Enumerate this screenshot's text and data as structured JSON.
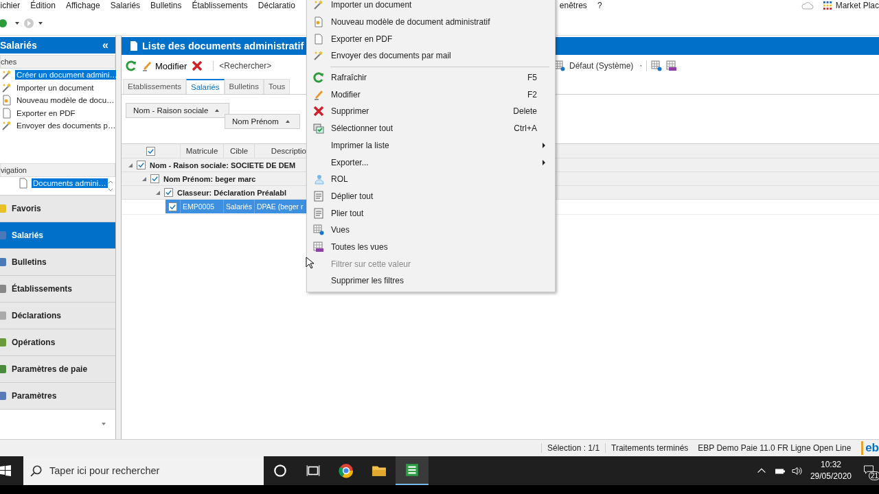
{
  "menu_bar": {
    "items": [
      "ichier",
      "Édition",
      "Affichage",
      "Salariés",
      "Bulletins",
      "Établissements",
      "Déclaratio"
    ],
    "items_right": [
      "enêtres",
      "?"
    ],
    "marketplace": "Market Plac"
  },
  "left_panel": {
    "title": "Salariés",
    "collapse": "«",
    "tasks_header": "ches",
    "tasks": [
      {
        "label": "Créer un document admini…",
        "selected": true
      },
      {
        "label": "Importer un document",
        "selected": false
      },
      {
        "label": "Nouveau modèle de docu…",
        "selected": false
      },
      {
        "label": "Exporter en PDF",
        "selected": false
      },
      {
        "label": "Envoyer des documents p…",
        "selected": false
      }
    ],
    "navigation_header": "vigation",
    "navigation": [
      {
        "label": "Documents admini…",
        "selected": true
      }
    ],
    "modules": [
      {
        "label": "Favoris",
        "selected": false
      },
      {
        "label": "Salariés",
        "selected": true
      },
      {
        "label": "Bulletins",
        "selected": false
      },
      {
        "label": "Établissements",
        "selected": false
      },
      {
        "label": "Déclarations",
        "selected": false
      },
      {
        "label": "Opérations",
        "selected": false
      },
      {
        "label": "Paramètres de paie",
        "selected": false
      },
      {
        "label": "Paramètres",
        "selected": false
      }
    ]
  },
  "main": {
    "title": "Liste des documents administratif",
    "toolbar": {
      "edit": "Modifier",
      "search_placeholder": "<Rechercher>",
      "view": "Défaut (Système)"
    },
    "tabs": [
      {
        "label": "Etablissements",
        "selected": false
      },
      {
        "label": "Salariés",
        "selected": true
      },
      {
        "label": "Bulletins",
        "selected": false
      },
      {
        "label": "Tous",
        "selected": false
      }
    ],
    "group_by": [
      "Nom - Raison sociale",
      "Nom Prénom"
    ],
    "grid": {
      "all_checked": true,
      "columns": [
        "Matricule",
        "Cible",
        "Descriptio"
      ],
      "groups": [
        {
          "label": "Nom - Raison sociale: SOCIETE DE DEM",
          "checked": true,
          "expanded": true,
          "children": [
            {
              "label": "Nom Prénom: beger marc",
              "checked": true,
              "expanded": true,
              "children": [
                {
                  "label": "Classeur: Déclaration Préalabl",
                  "checked": true,
                  "expanded": true,
                  "rows": [
                    {
                      "checked": true,
                      "selected": true,
                      "cells": [
                        "EMP0005",
                        "Salariés",
                        "DPAE (beger r"
                      ]
                    }
                  ]
                }
              ]
            }
          ]
        }
      ]
    }
  },
  "context_menu": {
    "items": [
      {
        "kind": "item",
        "label": "Importer un document"
      },
      {
        "kind": "item",
        "label": "Nouveau modèle de document administratif"
      },
      {
        "kind": "item",
        "label": "Exporter en PDF"
      },
      {
        "kind": "item",
        "label": "Envoyer des documents par mail"
      },
      {
        "kind": "separator"
      },
      {
        "kind": "item",
        "label": "Rafraîchir",
        "shortcut": "F5"
      },
      {
        "kind": "item",
        "label": "Modifier",
        "shortcut": "F2"
      },
      {
        "kind": "item",
        "label": "Supprimer",
        "shortcut": "Delete"
      },
      {
        "kind": "item",
        "label": "Sélectionner tout",
        "shortcut": "Ctrl+A"
      },
      {
        "kind": "item",
        "label": "Imprimer la liste",
        "submenu": true
      },
      {
        "kind": "item",
        "label": "Exporter...",
        "submenu": true
      },
      {
        "kind": "item",
        "label": "ROL"
      },
      {
        "kind": "item",
        "label": "Déplier tout"
      },
      {
        "kind": "item",
        "label": "Plier tout"
      },
      {
        "kind": "item",
        "label": "Vues"
      },
      {
        "kind": "item",
        "label": "Toutes les vues"
      },
      {
        "kind": "item",
        "label": "Filtrer sur cette valeur",
        "disabled": true
      },
      {
        "kind": "item",
        "label": "Supprimer les filtres"
      }
    ]
  },
  "status_bar": {
    "selection": "Sélection : 1/1",
    "status": "Traitements terminés",
    "product": "EBP Demo Paie 11.0 FR Ligne Open Line",
    "logo": "eb"
  },
  "taskbar": {
    "search_placeholder": "Taper ici pour rechercher",
    "time": "10:32",
    "date": "29/05/2020",
    "notifications": "21"
  }
}
